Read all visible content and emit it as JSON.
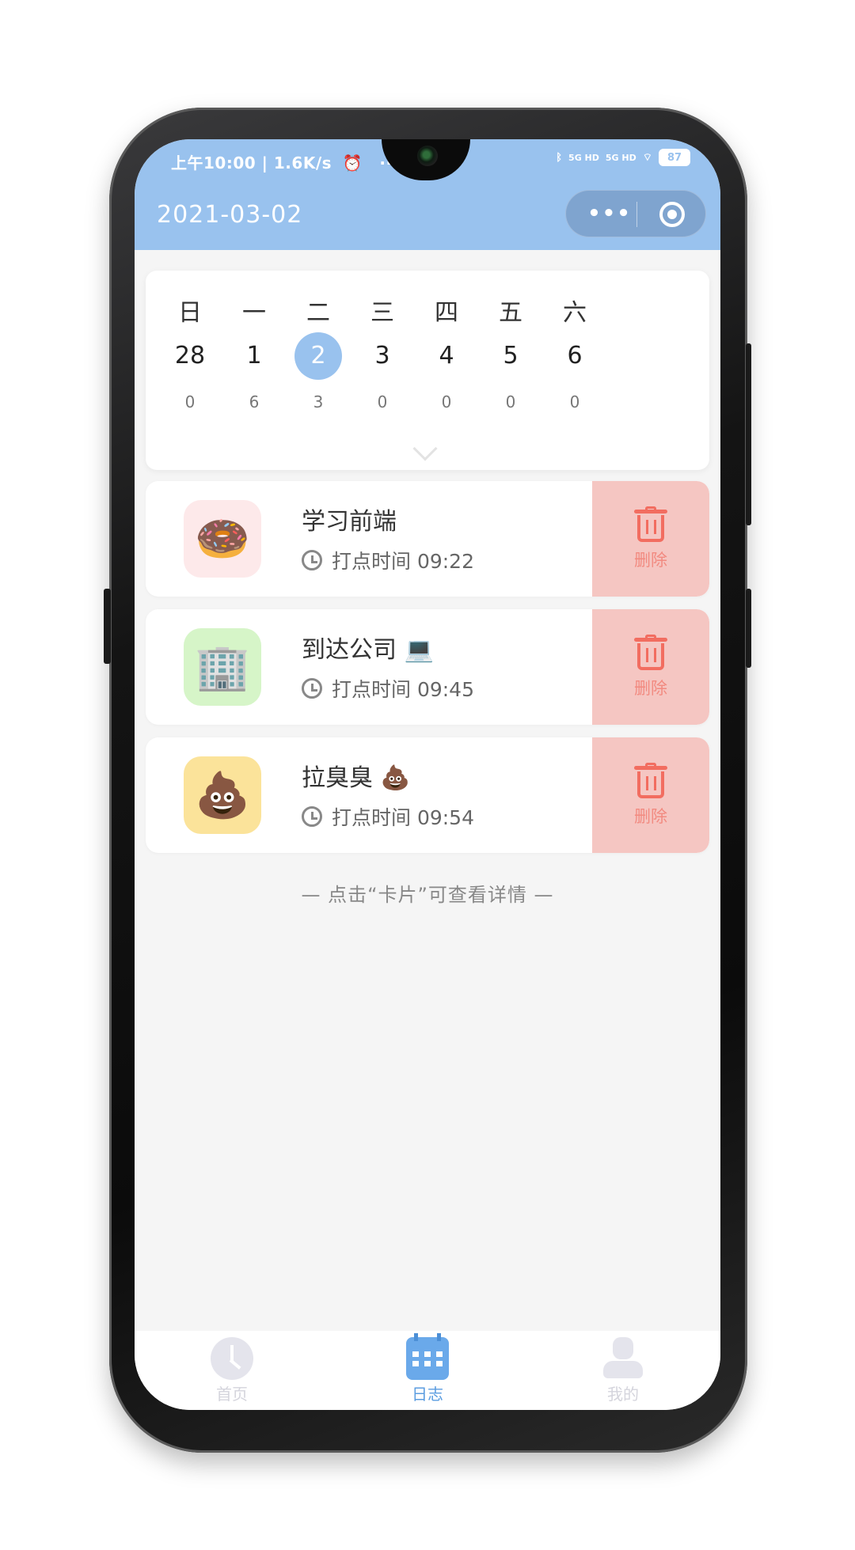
{
  "status_bar": {
    "time_speed": "上午10:00 | 1.6K/s",
    "more_dots": "···",
    "signal_1": "5G HD",
    "signal_2": "5G HD",
    "battery": "87"
  },
  "header": {
    "date": "2021-03-02",
    "more_glyph": "•••"
  },
  "calendar": {
    "days": [
      {
        "weekday": "日",
        "day": "28",
        "count": "0",
        "selected": false
      },
      {
        "weekday": "一",
        "day": "1",
        "count": "6",
        "selected": false
      },
      {
        "weekday": "二",
        "day": "2",
        "count": "3",
        "selected": true
      },
      {
        "weekday": "三",
        "day": "3",
        "count": "0",
        "selected": false
      },
      {
        "weekday": "四",
        "day": "4",
        "count": "0",
        "selected": false
      },
      {
        "weekday": "五",
        "day": "5",
        "count": "0",
        "selected": false
      },
      {
        "weekday": "六",
        "day": "6",
        "count": "0",
        "selected": false
      }
    ]
  },
  "records": [
    {
      "title": "学习前端",
      "time": "打点时间 09:22",
      "delete_label": "删除",
      "icon": "donut-icon",
      "emoji": "🍩",
      "bg": "#fde9ea"
    },
    {
      "title": "到达公司 💻",
      "time": "打点时间 09:45",
      "delete_label": "删除",
      "icon": "office-icon",
      "emoji": "🏢",
      "bg": "#d6f5c8"
    },
    {
      "title": "拉臭臭 💩",
      "time": "打点时间 09:54",
      "delete_label": "删除",
      "icon": "poop-icon",
      "emoji": "💩",
      "bg": "#fbe39a"
    }
  ],
  "hint": "— 点击“卡片”可查看详情 —",
  "tabbar": {
    "home": "首页",
    "log": "日志",
    "mine": "我的"
  },
  "colors": {
    "header_bg": "#99c2ee",
    "delete_bg": "#f5c6c2",
    "delete_red": "#f26d60",
    "tab_active": "#5b9de0"
  }
}
